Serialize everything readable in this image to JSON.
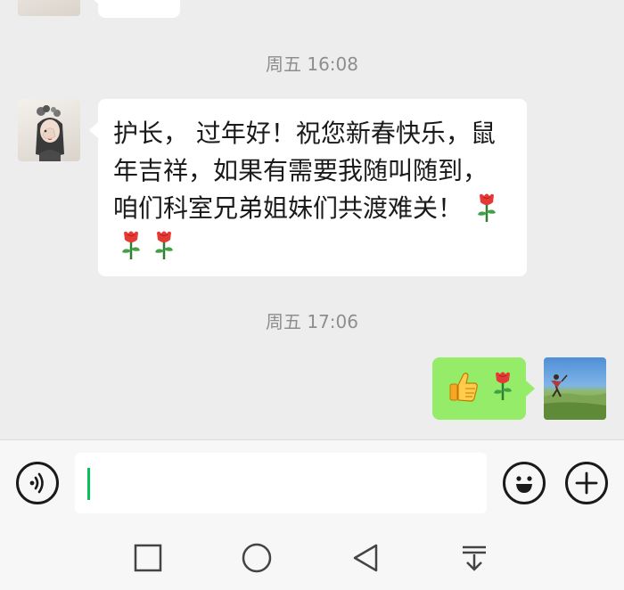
{
  "chat": {
    "messages": [
      {
        "timestamp": "周五 16:08",
        "sender": "other",
        "text": "护长， 过年好！祝您新春快乐，鼠\n年吉祥，如果有需要我随叫随到，\n咱们科室兄弟姐妹们共渡难关！ ",
        "emoji": [
          "rose",
          "rose",
          "rose"
        ]
      },
      {
        "timestamp": "周五 17:06",
        "sender": "self",
        "emoji": [
          "thumbs-up",
          "rose"
        ]
      }
    ]
  },
  "colors": {
    "chat_background": "#ededed",
    "self_bubble": "#95ec69",
    "other_bubble": "#ffffff",
    "caret": "#07c160",
    "timestamp_text": "#8e8e8e"
  },
  "input_bar": {
    "icons": [
      "voice-icon",
      "emoji-icon",
      "plus-icon"
    ],
    "value": ""
  },
  "nav_bar": {
    "icons": [
      "recent-apps-icon",
      "home-icon",
      "back-icon",
      "notification-pull-icon"
    ]
  }
}
